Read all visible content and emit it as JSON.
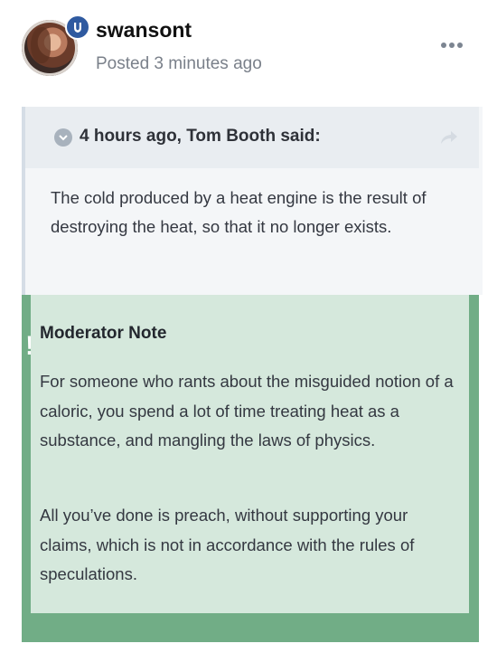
{
  "post": {
    "author": "swansont",
    "badge_glyph": " ",
    "posted": "Posted 3 minutes ago",
    "more_icon": "more-dots-icon"
  },
  "quote": {
    "citation": "4 hours ago, Tom Booth said:",
    "text": "The cold produced by a heat engine is the result of destroying the heat, so that it no longer exists."
  },
  "moderator_note": {
    "title": "Moderator Note",
    "paragraph1": "For someone who rants about the misguided notion of a caloric, you spend a lot of time treating heat as a substance, and mangling the laws of physics.",
    "paragraph2": "All you’ve done is preach, without supporting your claims, which is not in accordance with the rules of speculations."
  },
  "colors": {
    "moderator_green": "#71ad86",
    "moderator_bg": "#d5e8dc",
    "quote_bg": "#f4f6f8",
    "badge_blue": "#2f5aa0"
  }
}
